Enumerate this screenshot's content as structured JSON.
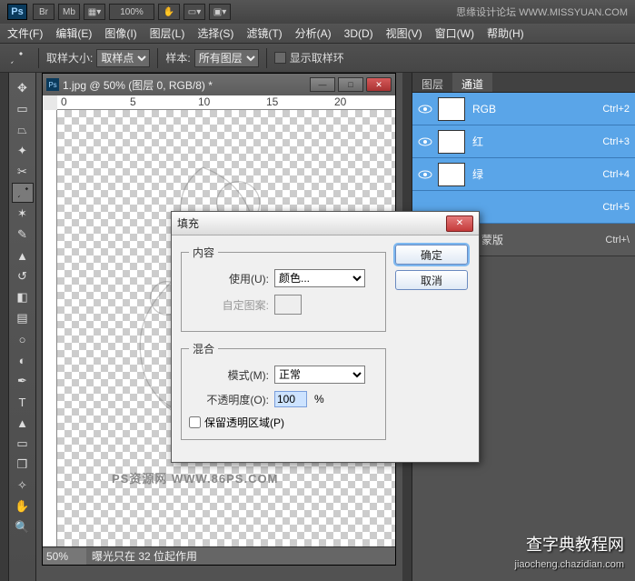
{
  "titlebar": {
    "ps": "Ps",
    "br": "Br",
    "mb": "Mb",
    "zoom_pct": "100%",
    "right_text": "思缘设计论坛   WWW.MISSYUAN.COM"
  },
  "menu": {
    "file": "文件(F)",
    "edit": "编辑(E)",
    "image": "图像(I)",
    "layer": "图层(L)",
    "select": "选择(S)",
    "filter": "滤镜(T)",
    "analysis": "分析(A)",
    "threeD": "3D(D)",
    "view": "视图(V)",
    "window": "窗口(W)",
    "help": "帮助(H)"
  },
  "options": {
    "sample_size_label": "取样大小:",
    "sample_size_value": "取样点",
    "sample_label": "样本:",
    "sample_value": "所有图层",
    "show_ring": "显示取样环"
  },
  "doc": {
    "title": "1.jpg @ 50% (图层 0, RGB/8) *",
    "zoom": "50%",
    "status": "曝光只在 32 位起作用",
    "watermark": "PS资源网  WWW.86PS.COM"
  },
  "panel": {
    "tab_layers": "图层",
    "tab_channels": "通道",
    "rows": [
      {
        "name": "RGB",
        "shortcut": "Ctrl+2"
      },
      {
        "name": "红",
        "shortcut": "Ctrl+3"
      },
      {
        "name": "绿",
        "shortcut": "Ctrl+4"
      },
      {
        "name": "",
        "shortcut": "Ctrl+5"
      },
      {
        "name": "0 蒙版",
        "shortcut": "Ctrl+\\"
      }
    ]
  },
  "dialog": {
    "title": "填充",
    "group_content": "内容",
    "use_label": "使用(U):",
    "use_value": "颜色...",
    "pattern_label": "自定图案:",
    "group_blend": "混合",
    "mode_label": "模式(M):",
    "mode_value": "正常",
    "opacity_label": "不透明度(O):",
    "opacity_value": "100",
    "pct": "%",
    "preserve": "保留透明区域(P)",
    "ok": "确定",
    "cancel": "取消"
  },
  "watermarks": {
    "w1": "查字典教程网",
    "w2": "jiaocheng.chazidian.com"
  }
}
